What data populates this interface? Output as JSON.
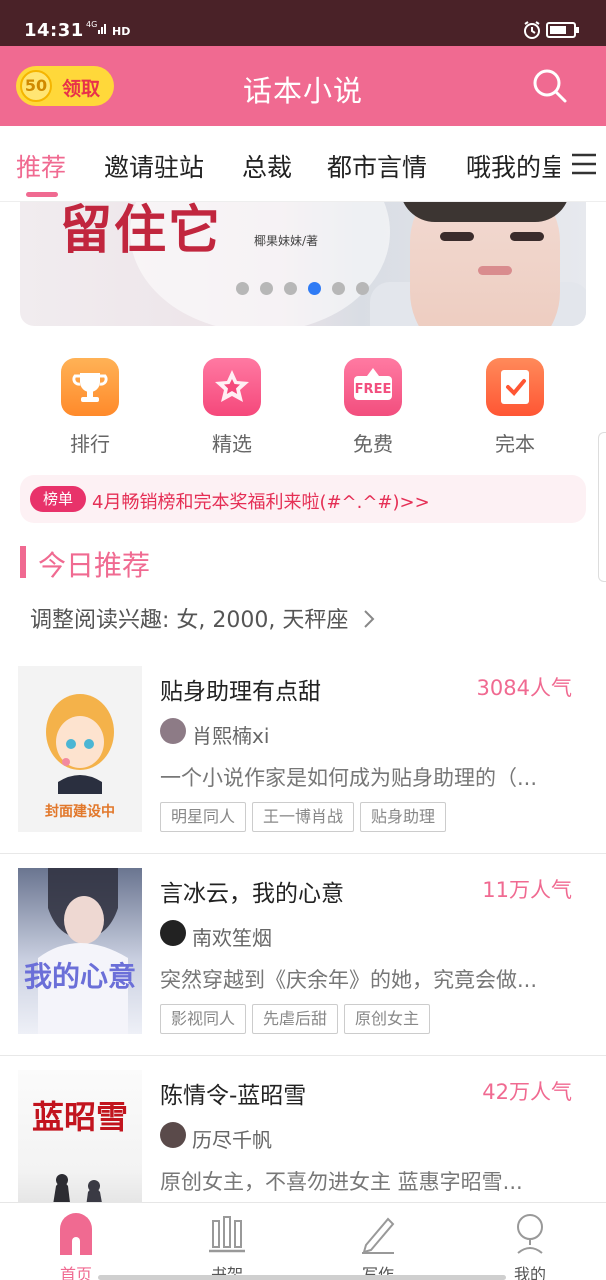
{
  "status_bar": {
    "time": "14:31",
    "network": "4G HD",
    "icons": [
      "signal-icon",
      "alarm-icon",
      "battery-icon"
    ]
  },
  "header": {
    "coin_count": "50",
    "claim_label": "领取",
    "app_title": "话本小说",
    "search_icon": "search-icon",
    "brand_color": "#f06a91"
  },
  "tabs": {
    "items": [
      "推荐",
      "邀请驻站",
      "总裁",
      "都市言情",
      "哦我的皇"
    ],
    "active_index": 0,
    "menu_icon": "menu-icon"
  },
  "banner": {
    "title_art": "留住它",
    "author": "椰果妹妹/著",
    "dot_count": 6,
    "active_dot": 3
  },
  "quick_links": [
    {
      "label": "排行",
      "icon": "trophy-icon",
      "color": "#ff9a3c"
    },
    {
      "label": "精选",
      "icon": "star-icon",
      "color": "#f5487b"
    },
    {
      "label": "免费",
      "icon": "free-tag-icon",
      "color": "#f24e7e"
    },
    {
      "label": "完本",
      "icon": "check-book-icon",
      "color": "#ff5634"
    }
  ],
  "notice": {
    "tag": "榜单",
    "message": "4月畅销榜和完本奖福利来啦(#^.^#)>>"
  },
  "section": {
    "title": "今日推荐",
    "interest": "调整阅读兴趣: 女, 2000, 天秤座"
  },
  "books": [
    {
      "title": "贴身助理有点甜",
      "popularity": "3084人气",
      "author": "肖熙楠xi",
      "description": "一个小说作家是如何成为贴身助理的（...",
      "tags": [
        "明星同人",
        "王一博肖战",
        "贴身助理"
      ],
      "cover_text": "封面建设中"
    },
    {
      "title": "言冰云，我的心意",
      "popularity": "11万人气",
      "author": "南欢笙烟",
      "description": "突然穿越到《庆余年》的她，究竟会做...",
      "tags": [
        "影视同人",
        "先虐后甜",
        "原创女主"
      ],
      "cover_text": "我的心意"
    },
    {
      "title": "陈情令-蓝昭雪",
      "popularity": "42万人气",
      "author": "历尽千帆",
      "description": "原创女主，不喜勿进女主 蓝惠字昭雪...",
      "tags": [],
      "cover_text": "蓝昭雪"
    }
  ],
  "bottom_nav": [
    {
      "label": "首页",
      "icon": "home-icon",
      "active": true
    },
    {
      "label": "书架",
      "icon": "bookshelf-icon",
      "active": false
    },
    {
      "label": "写作",
      "icon": "pen-icon",
      "active": false
    },
    {
      "label": "我的",
      "icon": "profile-icon",
      "active": false
    }
  ]
}
